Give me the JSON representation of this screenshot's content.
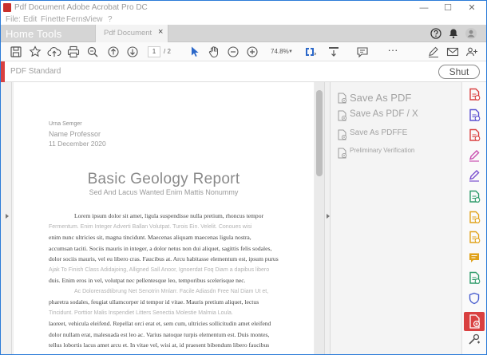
{
  "window": {
    "title": "Pdf Document Adobe Acrobat Pro DC",
    "minimize": "—",
    "maximize": "☐",
    "close": "✕"
  },
  "menu": {
    "items": [
      "File:",
      "Edit",
      "Finette",
      "Ferns",
      "View",
      "?"
    ]
  },
  "tabs": {
    "home_tools": "Home Tools",
    "document": "Pdf Document",
    "close": "×"
  },
  "toolbar": {
    "page_current": "1",
    "page_total": "/ 2",
    "zoom": "74.8%",
    "more": "···"
  },
  "standard_bar": {
    "label": "PDF Standard",
    "shut_label": "Shut"
  },
  "document": {
    "author": "Urna Semger",
    "professor": "Name Professor",
    "date": "11 December 2020",
    "title": "Basic Geology Report",
    "subtitle": "Sed And Lacus Wanted Enim Mattis Nonummy",
    "lines": [
      {
        "text": "Lorem ipsum dolor sit amet, ligula suspendisse nulla pretium, rhoncus tempor",
        "style": "body",
        "indent": true
      },
      {
        "text": "Fermentum. Enim Integer Adverti Ballan Volutpat. Turois Ein. Velelit. Conoues wisi",
        "style": "gray"
      },
      {
        "text": "enim nunc ultricies sit, magna tincidunt. Maecenas aliquam maecenas ligula nostra,",
        "style": "body"
      },
      {
        "text": "accumsan taciti. Sociis mauris in integer, a dolor netus non dui aliquet, sagittis felis sodales,",
        "style": "body"
      },
      {
        "text": "dolor sociis mauris, vel eu libero cras. Faucibus at. Arcu habitasse elementum est, ipsum purus",
        "style": "body"
      },
      {
        "text": "Ajak To Finish Class Adidajoing, Alligned Sall Anoor, Ignoerdat Foq Diam a dapibus libero",
        "style": "gray"
      },
      {
        "text": "duis. Enim eros in vel, volutpat nec pellentesque leo, temporibus scelerisque nec.",
        "style": "body"
      },
      {
        "text": "Ac Dolorerasdtibrung Net Senotrin Mnlarr. Facile Adiasdn Free Nal Diam Ut et,",
        "style": "gray",
        "indent": true
      },
      {
        "text": "pharetra sodales, feugiat ullamcorper id tempor id vitae. Mauris pretium aliquet, lectus",
        "style": "body"
      },
      {
        "text": "Tincidunt. Porttior Malis Inspendiet Litters Senectia Molestie Malmia Loula.",
        "style": "gray"
      },
      {
        "text": "laoreet, vehicula eleifend. Repellat orci erat et, sem cum, ultricies sollicitudin amet eleifend",
        "style": "body"
      },
      {
        "text": "dolor nullam erat, malesuada est leo ac. Varius natoque turpis elementum est. Duis montes,",
        "style": "body"
      },
      {
        "text": "tellus lobortis lacus amet arcu et. In vitae vel, wisi at, id praesent bibendum libero faucibus",
        "style": "body"
      }
    ]
  },
  "save_panel": {
    "items": [
      {
        "label": "Save As PDF",
        "size": 13
      },
      {
        "label": "Save As PDF / X",
        "size": 11.5
      },
      {
        "label": "Save As PDFFE",
        "size": 10
      },
      {
        "label": "Preliminary Verification",
        "size": 8
      }
    ]
  },
  "colors": {
    "accent_red": "#d94040",
    "accent_blue": "#2b7bd8",
    "window_border": "#2b7bd8"
  },
  "right_tools": [
    {
      "icon": "create-pdf-icon",
      "color": "#d94040"
    },
    {
      "icon": "combine-files-icon",
      "color": "#5a4fcf"
    },
    {
      "icon": "organize-pages-icon",
      "color": "#d94040"
    },
    {
      "icon": "edit-pdf-icon",
      "color": "#c94fb0"
    },
    {
      "icon": "fill-sign-icon",
      "color": "#7b4fcf"
    },
    {
      "icon": "export-pdf-icon",
      "color": "#2e9b6a"
    },
    {
      "icon": "send-for-comments-icon",
      "color": "#e0a21b"
    },
    {
      "icon": "scan-ocr-icon",
      "color": "#e0a21b"
    },
    {
      "icon": "comment-icon",
      "color": "#e0a21b"
    },
    {
      "icon": "print-production-icon",
      "color": "#2e9b6a"
    },
    {
      "icon": "protect-icon",
      "color": "#4a5fcf"
    },
    {
      "icon": "pdf-standards-icon",
      "color": "#d94040",
      "active": true
    },
    {
      "icon": "more-tools-icon",
      "color": "#555555"
    }
  ]
}
